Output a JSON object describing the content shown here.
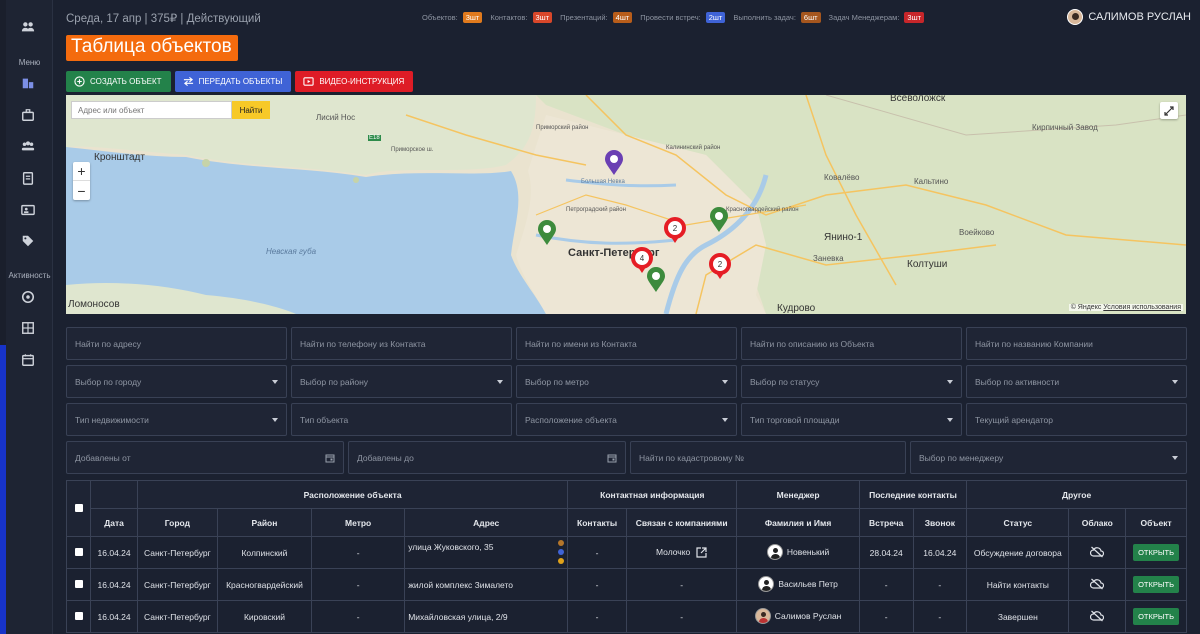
{
  "topbar": {
    "date_info": "Среда, 17 апр | 375₽ | Действующий",
    "stats": [
      {
        "label": "Объектов:",
        "value": "3шт",
        "color": "#e07a1d"
      },
      {
        "label": "Контактов:",
        "value": "3шт",
        "color": "#d8472a"
      },
      {
        "label": "Презентаций:",
        "value": "4шт",
        "color": "#b85d1a"
      },
      {
        "label": "Провести встреч:",
        "value": "2шт",
        "color": "#3f63d6"
      },
      {
        "label": "Выполнить задач:",
        "value": "6шт",
        "color": "#a5561e"
      },
      {
        "label": "Задач Менеджерам:",
        "value": "3шт",
        "color": "#c7262a"
      }
    ],
    "user_name": "САЛИМОВ РУСЛАН"
  },
  "sidebar": {
    "menu_label": "Меню",
    "activity_label": "Активность"
  },
  "page_title": "Таблица объектов",
  "actions": {
    "create": "СОЗДАТЬ ОБЪЕКТ",
    "transfer": "ПЕРЕДАТЬ ОБЪЕКТЫ",
    "video": "ВИДЕО-ИНСТРУКЦИЯ"
  },
  "map": {
    "search_placeholder": "Адрес или объект",
    "search_button": "Найти",
    "zoom_in": "+",
    "zoom_out": "−",
    "labels": {
      "vsevolozhsk": "Всеволожск",
      "lisiy_nos": "Лисий Нос",
      "kronshtadt": "Кронштадт",
      "nevskaya_guba": "Невская губа",
      "spb": "Санкт-Петербург",
      "yanino": "Янино-1",
      "koltushi": "Колтуши",
      "kudrovo": "Кудрово",
      "lomonosov": "Ломоносов",
      "kovalevo": "Ковалёво",
      "kaltino": "Кальтино",
      "voeykovo": "Воейково",
      "zanevka": "Заневка",
      "kirpichny": "Кирпичный Завод",
      "primorsky": "Приморский район",
      "kalininsky": "Калининский район",
      "petrogradsky": "Петроградский район",
      "krasnogvardeysky": "Красногвардейский район",
      "bolshaya_nevka": "Большая Невка",
      "nevka_hint": "Приморское ш.",
      "e18": "E18"
    },
    "copyright_brand": "© Яндекс",
    "copyright_link": "Условия использования",
    "clusters": [
      "2",
      "4",
      "2"
    ]
  },
  "filters": {
    "row1": [
      "Найти по адресу",
      "Найти по телефону из Контакта",
      "Найти по имени из Контакта",
      "Найти по описанию из Объекта",
      "Найти по названию Компании"
    ],
    "row2": [
      "Выбор по городу",
      "Выбор по району",
      "Выбор по метро",
      "Выбор по статусу",
      "Выбор по активности"
    ],
    "row3": [
      "Тип недвижимости",
      "Тип объекта",
      "Расположение объекта",
      "Тип торговой площади",
      "Текущий арендатор"
    ],
    "row4": [
      "Добавлены от",
      "Добавлены до",
      "Найти по кадастровому №",
      "Выбор по менеджеру"
    ]
  },
  "table": {
    "groups": [
      "Расположение объекта",
      "Контактная информация",
      "Менеджер",
      "Последние контакты",
      "Другое"
    ],
    "columns": [
      "Дата",
      "Город",
      "Район",
      "Метро",
      "Адрес",
      "Контакты",
      "Связан с компаниями",
      "Фамилия и Имя",
      "Встреча",
      "Звонок",
      "Статус",
      "Облако",
      "Объект"
    ],
    "open_label": "ОТКРЫТЬ",
    "rows": [
      {
        "date": "16.04.24",
        "city": "Санкт-Петербург",
        "district": "Колпинский",
        "metro": "-",
        "address": "улица Жуковского, 35",
        "contacts": "-",
        "company": "Молочко",
        "manager": "Новенький",
        "meeting": "28.04.24",
        "call": "16.04.24",
        "status": "Обсуждение договора"
      },
      {
        "date": "16.04.24",
        "city": "Санкт-Петербург",
        "district": "Красногвардейский",
        "metro": "-",
        "address": "жилой комплекс Зималето",
        "contacts": "-",
        "company": "-",
        "manager": "Васильев Петр",
        "meeting": "-",
        "call": "-",
        "status": "Найти контакты"
      },
      {
        "date": "16.04.24",
        "city": "Санкт-Петербург",
        "district": "Кировский",
        "metro": "-",
        "address": "Михайловская улица, 2/9",
        "contacts": "-",
        "company": "-",
        "manager": "Салимов Руслан",
        "meeting": "-",
        "call": "-",
        "status": "Завершен"
      }
    ]
  }
}
